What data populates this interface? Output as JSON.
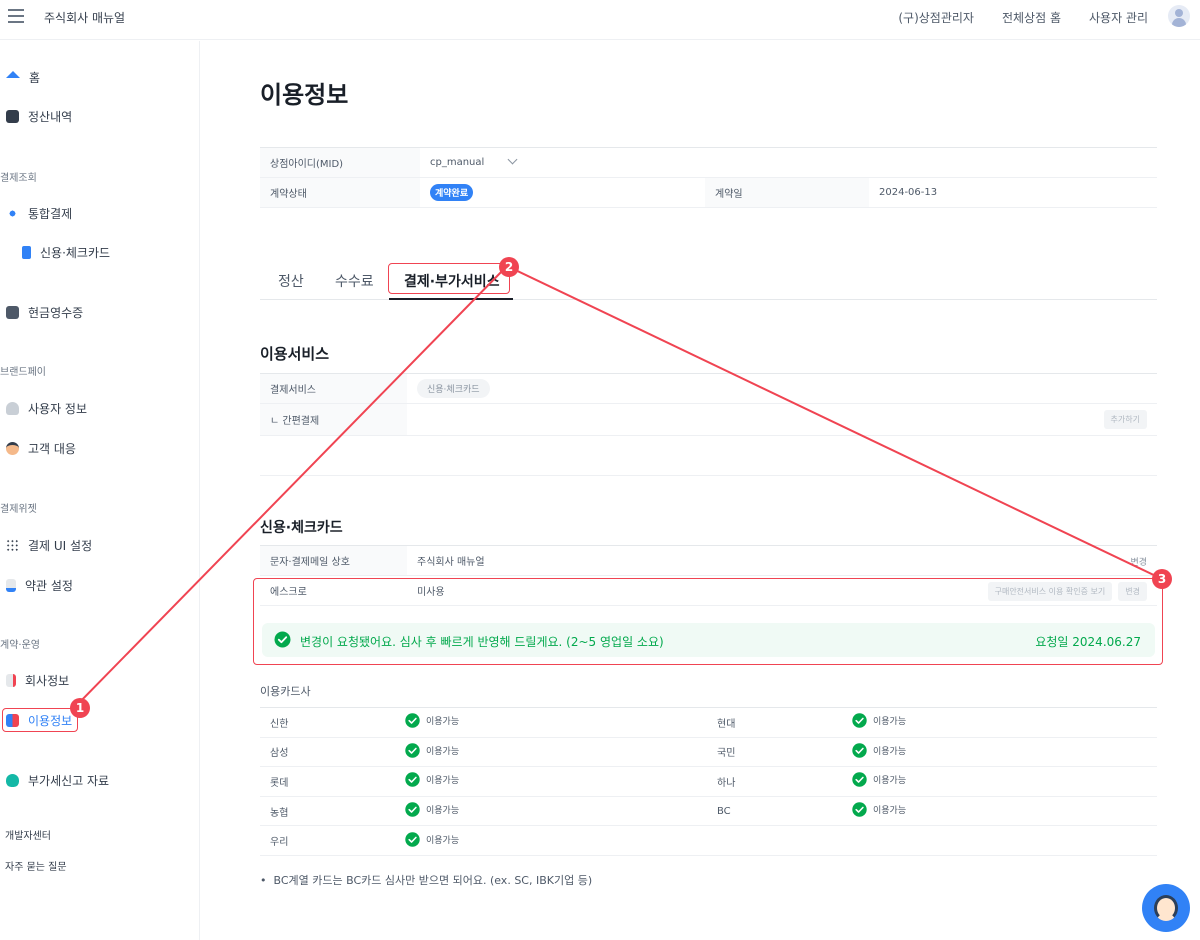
{
  "header": {
    "brand": "주식회사 매뉴얼",
    "nav": [
      "(구)상점관리자",
      "전체상점 홈",
      "사용자 관리"
    ]
  },
  "sidebar": {
    "home": "홈",
    "settlement": "정산내역",
    "section_payment_lookup": "결제조회",
    "integrated_payment": "통합결제",
    "credit_card": "신용·체크카드",
    "cash_receipt": "현금영수증",
    "section_brandpay": "브랜드페이",
    "user_info": "사용자 정보",
    "customer_service": "고객 대응",
    "section_widget": "결제위젯",
    "widget_ui": "결제 UI 설정",
    "terms": "약관 설정",
    "section_contract": "계약·운영",
    "company_info": "회사정보",
    "usage_info": "이용정보",
    "vat_data": "부가세신고 자료",
    "developer_center": "개발자센터",
    "faq": "자주 묻는 질문"
  },
  "page": {
    "title": "이용정보",
    "mid_label": "상점아이디(MID)",
    "mid_value": "cp_manual",
    "contract_status_label": "계약상태",
    "contract_status_badge": "계약완료",
    "contract_date_label": "계약일",
    "contract_date_value": "2024-06-13"
  },
  "tabs": [
    "정산",
    "수수료",
    "결제·부가서비스"
  ],
  "service": {
    "title": "이용서비스",
    "payment_service_label": "결제서비스",
    "payment_service_chip": "신용·체크카드",
    "easy_pay_label": "ㄴ 간편결제",
    "add_button": "추가하기"
  },
  "card": {
    "title": "신용·체크카드",
    "merchant_name_label": "문자·결제메일 상호",
    "merchant_name_value": "주식회사 매뉴얼",
    "change_button": "변경",
    "escrow_label": "에스크로",
    "escrow_value": "미사용",
    "escrow_view_button": "구매안전서비스 이용 확인증 보기",
    "escrow_change_button": "변경",
    "notice_message": "변경이 요청됐어요. 심사 후 빠르게 반영해 드릴게요. (2~5 영업일 소요)",
    "notice_date": "요청일 2024.06.27"
  },
  "card_companies": {
    "title": "이용카드사",
    "status": "이용가능",
    "rows": [
      [
        "신한",
        "현대"
      ],
      [
        "삼성",
        "국민"
      ],
      [
        "롯데",
        "하나"
      ],
      [
        "농협",
        "BC"
      ],
      [
        "우리",
        ""
      ]
    ]
  },
  "footnote": "BC계열 카드는 BC카드 심사만 받으면 되어요. (ex. SC, IBK기업 등)",
  "annotations": [
    "1",
    "2",
    "3"
  ],
  "colors": {
    "accent": "#3182f6",
    "annotation": "#f04452",
    "success": "#03a94d"
  }
}
